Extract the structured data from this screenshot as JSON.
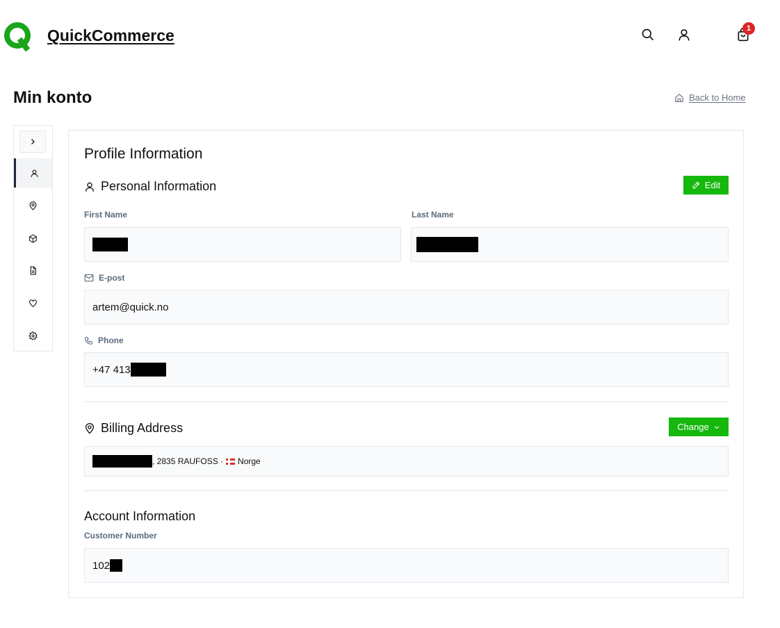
{
  "header": {
    "brand": "QuickCommerce",
    "cart_count": "1",
    "icons": [
      "search-icon",
      "user-icon",
      "cart-icon"
    ]
  },
  "page": {
    "title": "Min konto",
    "back_link": "Back to Home"
  },
  "sidebar": {
    "items": [
      {
        "icon": "user-icon",
        "active": true
      },
      {
        "icon": "map-pin-icon",
        "active": false
      },
      {
        "icon": "package-icon",
        "active": false
      },
      {
        "icon": "file-text-icon",
        "active": false
      },
      {
        "icon": "heart-icon",
        "active": false
      },
      {
        "icon": "settings-icon",
        "active": false
      }
    ]
  },
  "profile": {
    "title": "Profile Information",
    "personal": {
      "heading": "Personal Information",
      "edit_label": "Edit",
      "first_name_label": "First Name",
      "last_name_label": "Last Name",
      "email_label": "E-post",
      "email_value": "artem@quick.no",
      "phone_label": "Phone",
      "phone_value": "+47 413"
    },
    "billing": {
      "heading": "Billing Address",
      "change_label": "Change",
      "address_text": ", 2835 RAUFOSS · ",
      "country": "Norge"
    },
    "account": {
      "heading": "Account Information",
      "customer_number_label": "Customer Number",
      "customer_number_value": "102"
    }
  },
  "colors": {
    "accent_green": "#16b80e",
    "badge_red": "#dc2626",
    "logo_green": "#1aa51a"
  }
}
